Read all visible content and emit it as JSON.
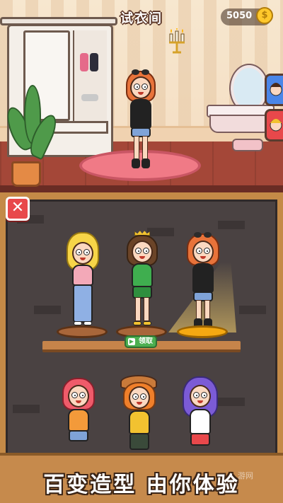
{
  "header": {
    "title": "试衣间",
    "coins": "5050",
    "coin_symbol": "$"
  },
  "room": {
    "side_tabs": [
      {
        "icon": "avatar-portrait-icon"
      },
      {
        "icon": "avatar-portrait-icon"
      }
    ]
  },
  "wardrobe_panel": {
    "close_symbol": "✕",
    "claim_button_label": "领取",
    "claim_icon": "▶"
  },
  "banner": {
    "slogan": "百变造型 由你体验",
    "watermark": "游网"
  },
  "colors": {
    "accent": "#c68a4c",
    "close_red": "#e8484b",
    "claim_green": "#4caf50",
    "coin_gold": "#ffc82c"
  }
}
